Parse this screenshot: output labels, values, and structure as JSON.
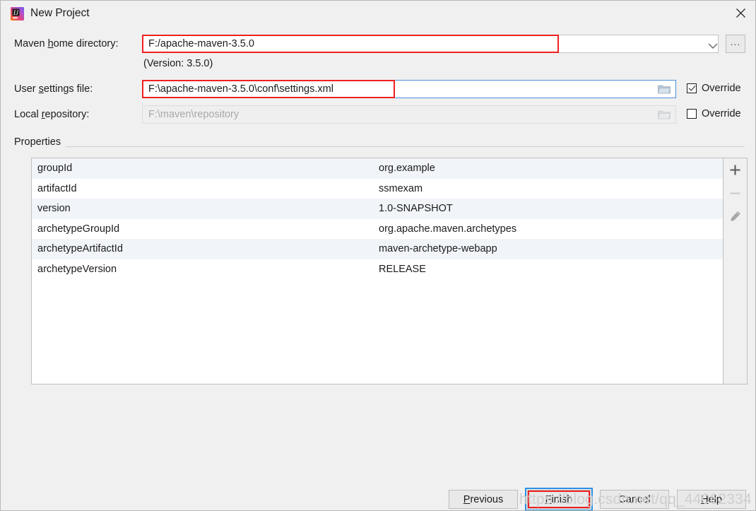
{
  "window": {
    "title": "New Project",
    "app_icon": "intellij-idea-icon",
    "close_icon": "close-icon"
  },
  "form": {
    "maven_home": {
      "label_pre": "Maven ",
      "label_mnemonic": "h",
      "label_post": "ome directory:",
      "value": "F:/apache-maven-3.5.0",
      "version_note": "(Version: 3.5.0)",
      "dropdown_icon": "chevron-down-icon",
      "browse_label": "..."
    },
    "user_settings": {
      "label_pre": "User ",
      "label_mnemonic": "s",
      "label_post": "ettings file:",
      "value": "F:\\apache-maven-3.5.0\\conf\\settings.xml",
      "folder_icon": "folder-icon",
      "override_label": "Override",
      "override_checked": true
    },
    "local_repository": {
      "label_pre": "Local ",
      "label_mnemonic": "r",
      "label_post": "epository:",
      "value": "F:\\maven\\repository",
      "folder_icon": "folder-icon",
      "override_label": "Override",
      "override_checked": false
    }
  },
  "properties": {
    "caption": "Properties",
    "rows": [
      {
        "key": "groupId",
        "value": "org.example"
      },
      {
        "key": "artifactId",
        "value": "ssmexam"
      },
      {
        "key": "version",
        "value": "1.0-SNAPSHOT"
      },
      {
        "key": "archetypeGroupId",
        "value": "org.apache.maven.archetypes"
      },
      {
        "key": "archetypeArtifactId",
        "value": "maven-archetype-webapp"
      },
      {
        "key": "archetypeVersion",
        "value": "RELEASE"
      }
    ],
    "toolbar": {
      "add_icon": "plus-icon",
      "remove_icon": "minus-icon",
      "edit_icon": "pencil-icon"
    }
  },
  "buttons": {
    "previous": {
      "pre": "",
      "mnemonic": "P",
      "post": "revious"
    },
    "finish": {
      "pre": "",
      "mnemonic": "F",
      "post": "inish"
    },
    "cancel": {
      "pre": "Cancel",
      "mnemonic": "",
      "post": ""
    },
    "help": {
      "pre": "",
      "mnemonic": "H",
      "post": "elp"
    }
  },
  "watermark": {
    "text": "https://blog.csdn.net/qq_44062334"
  },
  "colors": {
    "annotation_red": "#f02020",
    "focus_blue": "#2e8fe0",
    "dialog_bg": "#f0f0f0",
    "row_alt": "#f1f4f9"
  }
}
